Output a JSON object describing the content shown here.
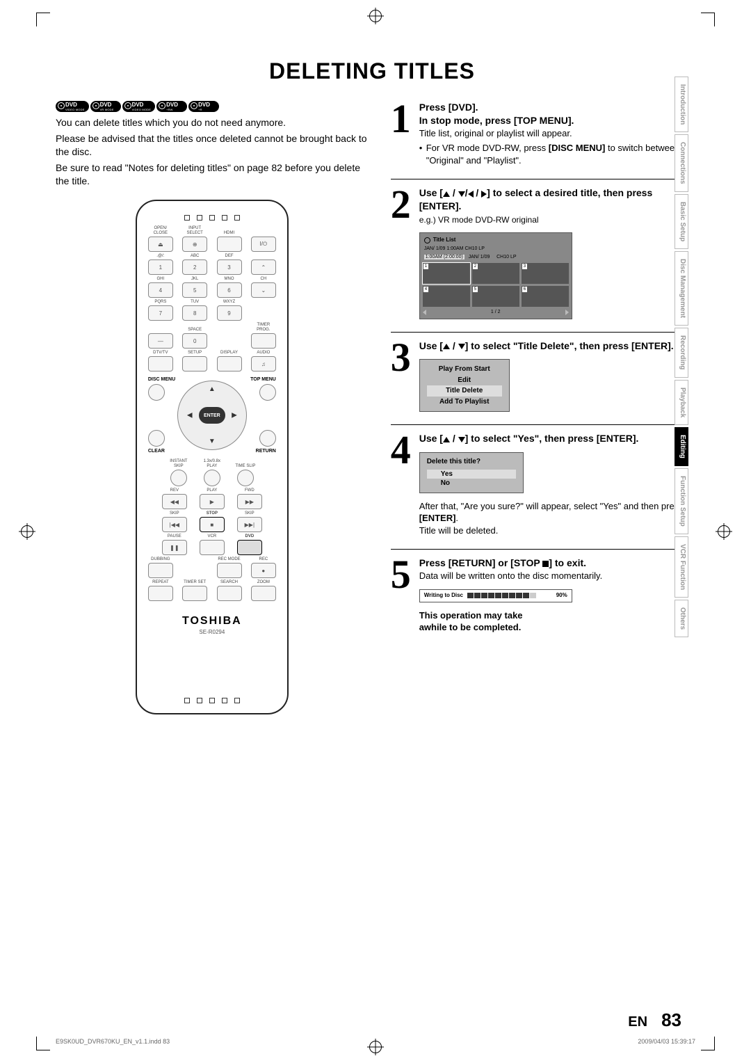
{
  "title": "DELETING TITLES",
  "dvd_badges": [
    {
      "top": "DVD",
      "bot": "VIDEO MODE",
      "sub": "-RW"
    },
    {
      "top": "DVD",
      "bot": "VR MODE",
      "sub": "-RW"
    },
    {
      "top": "DVD",
      "bot": "VIDEO MODE",
      "sub": "-R"
    },
    {
      "top": "DVD",
      "bot": "+RW",
      "sub": ""
    },
    {
      "top": "DVD",
      "bot": "+R",
      "sub": ""
    }
  ],
  "intro": {
    "p1": "You can delete titles which you do not need anymore.",
    "p2": "Please be advised that the titles once deleted cannot be brought back to the disc.",
    "p3": "Be sure to read \"Notes for deleting titles\" on page 82 before you delete the title."
  },
  "remote": {
    "row1": [
      "OPEN/\nCLOSE",
      "INPUT\nSELECT",
      "HDMI",
      ""
    ],
    "row1_icons": [
      "⏏",
      "⊕",
      "",
      "I/⏻"
    ],
    "keypad_labels": [
      ".@/:",
      "ABC",
      "DEF",
      "",
      "GHI",
      "JKL",
      "MNO",
      "CH",
      "PQRS",
      "TUV",
      "WXYZ",
      "",
      "",
      "SPACE",
      "",
      "TIMER\nPROG."
    ],
    "keypad_nums": [
      "1",
      "2",
      "3",
      "⌃",
      "4",
      "5",
      "6",
      "⌄",
      "7",
      "8",
      "9",
      "",
      "—",
      "0",
      "",
      ""
    ],
    "row_func1": [
      "DTV/TV",
      "SETUP",
      "DISPLAY",
      "AUDIO"
    ],
    "disc_menu": "DISC MENU",
    "top_menu": "TOP MENU",
    "enter": "ENTER",
    "clear": "CLEAR",
    "return": "RETURN",
    "row_func2": [
      "INSTANT\nSKIP",
      "1.3x/0.8x\nPLAY",
      "TIME SLIP"
    ],
    "transport_labels": [
      "REV",
      "PLAY",
      "FWD"
    ],
    "transport2_labels": [
      "SKIP",
      "STOP",
      "SKIP"
    ],
    "transport3_labels": [
      "PAUSE",
      "VCR",
      "DVD"
    ],
    "row_func3": [
      "DUBBING",
      "",
      "REC MODE",
      "REC"
    ],
    "row_func4": [
      "REPEAT",
      "TIMER SET",
      "SEARCH",
      "ZOOM"
    ],
    "brand": "TOSHIBA",
    "model": "SE-R0294"
  },
  "steps": {
    "s1": {
      "head1": "Press [DVD].",
      "head2": "In stop mode, press [TOP MENU].",
      "body": "Title list, original or playlist will appear.",
      "bullet_pre": "For VR mode DVD-RW, press ",
      "bullet_bold": "[DISC MENU]",
      "bullet_post": " to switch between \"Original\" and \"Playlist\"."
    },
    "s2": {
      "head_pre": "Use [",
      "head_mid": "] to select a desired title, then press [ENTER].",
      "eg": "e.g.) VR mode DVD-RW original",
      "title_list": {
        "header": "Title List",
        "info1": "JAN/ 1/09 1:00AM  CH10   LP",
        "info2_a": "1:00AM (2:00:00)",
        "info2_b": "JAN/ 1/09",
        "info2_c": "CH10   LP",
        "cells": [
          "1",
          "2",
          "3",
          "4",
          "5",
          "6"
        ],
        "page": "1 / 2"
      }
    },
    "s3": {
      "head_pre": "Use [",
      "head_post": "] to select \"Title Delete\", then press [ENTER].",
      "menu": [
        "Play From Start",
        "Edit",
        "Title Delete",
        "Add To Playlist"
      ],
      "selected": 2
    },
    "s4": {
      "head_pre": "Use [",
      "head_post": "] to select \"Yes\", then press [ENTER].",
      "confirm_q": "Delete this title?",
      "confirm_opts": [
        "Yes",
        "No"
      ],
      "after1": "After that, \"Are you sure?\" will appear, select \"Yes\" and then press ",
      "after1_bold": "[ENTER]",
      "after1_end": ".",
      "after2": "Title will be deleted."
    },
    "s5": {
      "head_pre": "Press [RETURN] or [STOP ",
      "head_post": "] to exit.",
      "body": "Data will be written onto the disc momentarily.",
      "writing": "Writing to Disc",
      "pct": "90%",
      "note1": "This operation may take",
      "note2": "awhile to be completed."
    }
  },
  "tabs": [
    "Introduction",
    "Connections",
    "Basic Setup",
    "Disc Management",
    "Recording",
    "Playback",
    "Editing",
    "Function Setup",
    "VCR Function",
    "Others"
  ],
  "active_tab": 6,
  "footer": {
    "lang": "EN",
    "page": "83"
  },
  "imprint": {
    "left": "E9SK0UD_DVR670KU_EN_v1.1.indd   83",
    "right": "2009/04/03   15:39:17"
  }
}
